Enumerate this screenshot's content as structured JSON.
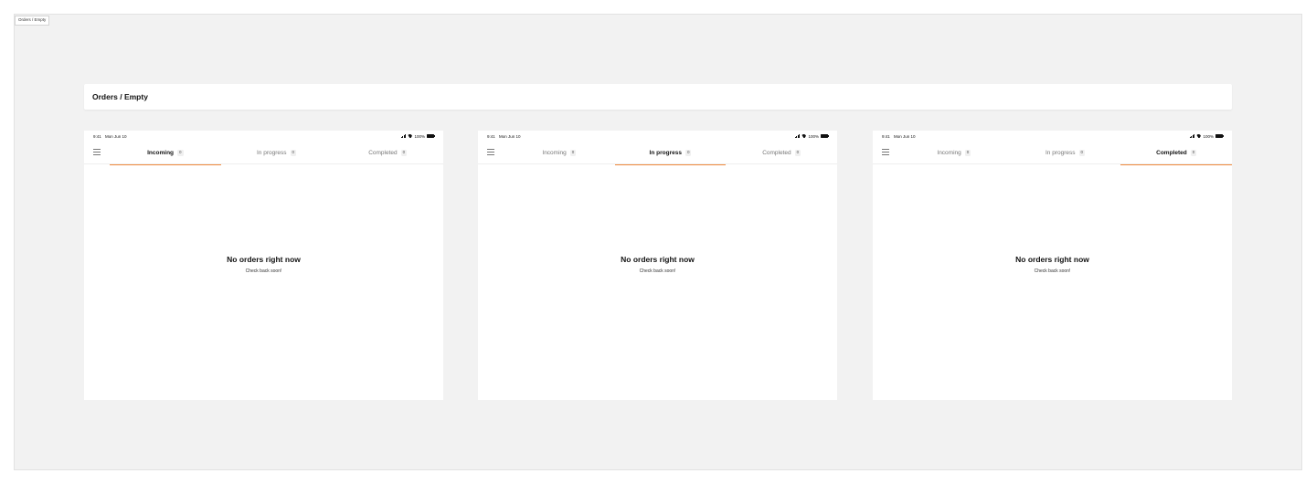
{
  "frame_label": "Orders / Empty",
  "page_title": "Orders / Empty",
  "status_bar": {
    "time": "9:41",
    "date": "Mon Jun 10",
    "battery": "100%",
    "icons": [
      "signal-icon",
      "wifi-icon",
      "battery-icon"
    ]
  },
  "tabs": [
    {
      "label": "Incoming",
      "count": "0"
    },
    {
      "label": "In progress",
      "count": "0"
    },
    {
      "label": "Completed",
      "count": "0"
    }
  ],
  "empty_state": {
    "title": "No orders right now",
    "subtitle": "Check back soon!"
  },
  "devices": [
    {
      "active_tab": "Incoming"
    },
    {
      "active_tab": "In progress"
    },
    {
      "active_tab": "Completed"
    }
  ],
  "colors": {
    "accent": "#f08a3e",
    "canvas_background": "#f2f2f2",
    "surface": "#ffffff",
    "text_primary": "#111111",
    "text_muted": "#777777"
  }
}
